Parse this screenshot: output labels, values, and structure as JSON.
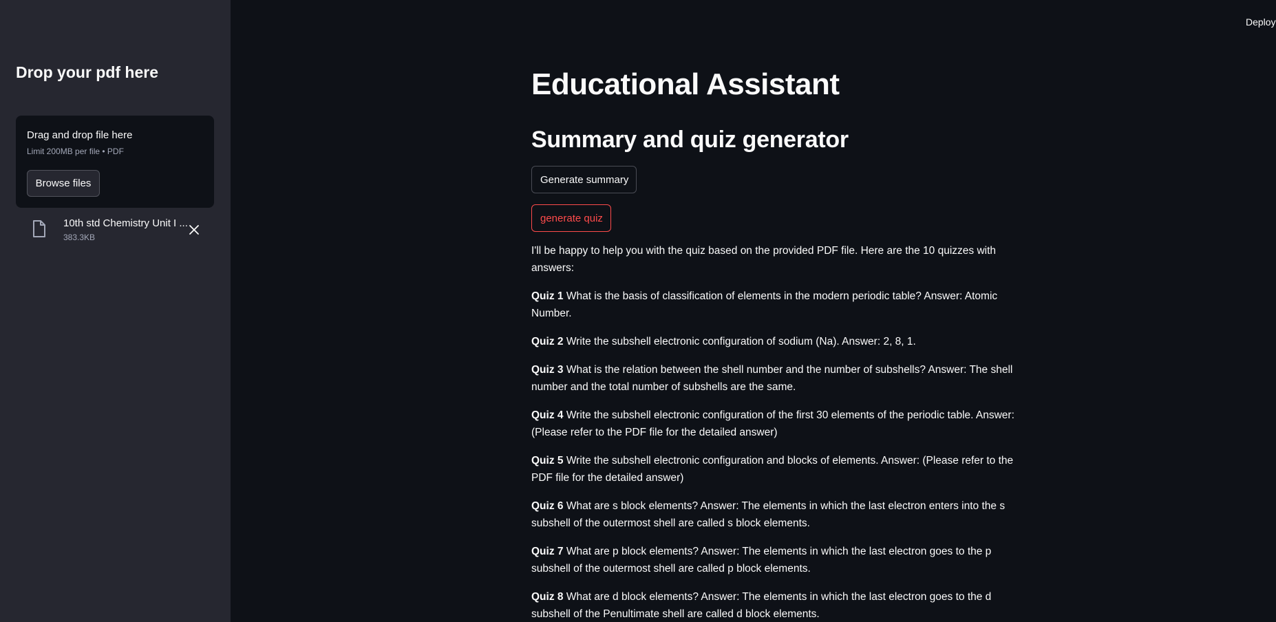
{
  "header": {
    "deploy_label": "Deploy"
  },
  "sidebar": {
    "title": "Drop your pdf here",
    "uploader": {
      "title": "Drag and drop file here",
      "limit": "Limit 200MB per file • PDF",
      "browse_label": "Browse files"
    },
    "file": {
      "name": "10th std Chemistry Unit I ...",
      "size": "383.3KB"
    }
  },
  "main": {
    "title": "Educational Assistant",
    "subtitle": "Summary and quiz generator",
    "summary_button": "Generate summary",
    "quiz_button": "generate quiz",
    "intro": "I'll be happy to help you with the quiz based on the provided PDF file. Here are the 10 quizzes with answers:",
    "quizzes": [
      {
        "label": "Quiz 1",
        "text": "What is the basis of classification of elements in the modern periodic table? Answer: Atomic Number."
      },
      {
        "label": "Quiz 2",
        "text": "Write the subshell electronic configuration of sodium (Na). Answer: 2, 8, 1."
      },
      {
        "label": "Quiz 3",
        "text": "What is the relation between the shell number and the number of subshells? Answer: The shell number and the total number of subshells are the same."
      },
      {
        "label": "Quiz 4",
        "text": "Write the subshell electronic configuration of the first 30 elements of the periodic table. Answer: (Please refer to the PDF file for the detailed answer)"
      },
      {
        "label": "Quiz 5",
        "text": "Write the subshell electronic configuration and blocks of elements. Answer: (Please refer to the PDF file for the detailed answer)"
      },
      {
        "label": "Quiz 6",
        "text": "What are s block elements? Answer: The elements in which the last electron enters into the s subshell of the outermost shell are called s block elements."
      },
      {
        "label": "Quiz 7",
        "text": "What are p block elements? Answer: The elements in which the last electron goes to the p subshell of the outermost shell are called p block elements."
      },
      {
        "label": "Quiz 8",
        "text": "What are d block elements? Answer: The elements in which the last electron goes to the d subshell of the Penultimate shell are called d block elements."
      }
    ]
  },
  "colors": {
    "background": "#0e1117",
    "sidebar": "#262730",
    "accent": "#ff4b4b"
  }
}
